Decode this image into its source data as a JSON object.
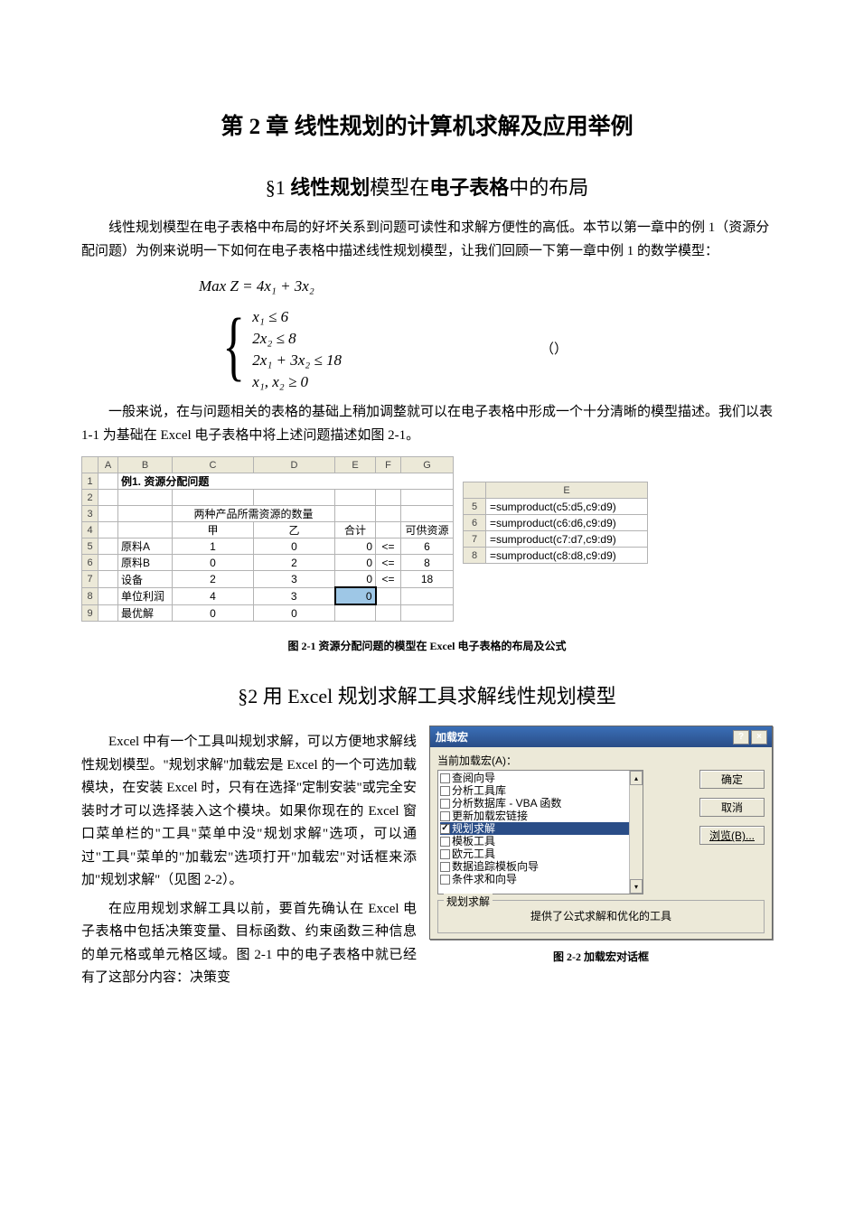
{
  "chapter": {
    "title": "第 2 章  线性规划的计算机求解及应用举例"
  },
  "section1": {
    "title_prefix": "§1 ",
    "title_b1": "线性规划",
    "title_r1": "模型在",
    "title_b2": "电子表格",
    "title_r2": "中的布局",
    "para1": "线性规划模型在电子表格中布局的好坏关系到问题可读性和求解方便性的高低。本节以第一章中的例 1（资源分配问题）为例来说明一下如何在电子表格中描述线性规划模型，让我们回顾一下第一章中例 1 的数学模型：",
    "math": {
      "objective": "Max    Z = 4x₁ + 3x₂",
      "c1": "x₁ ≤ 6",
      "c2": "2x₂ ≤ 8",
      "c3": "2x₁ + 3x₂ ≤ 18",
      "c4": "x₁, x₂ ≥ 0",
      "paren": "（）"
    },
    "para2": "一般来说，在与问题相关的表格的基础上稍加调整就可以在电子表格中形成一个十分清晰的模型描述。我们以表 1-1 为基础在 Excel 电子表格中将上述问题描述如图 2-1。"
  },
  "figure21": {
    "left_table": {
      "col_headers": [
        "",
        "A",
        "B",
        "C",
        "D",
        "E",
        "F",
        "G"
      ],
      "row_headers": [
        "1",
        "2",
        "3",
        "4",
        "5",
        "6",
        "7",
        "8",
        "9"
      ],
      "r1_b": "例1. 资源分配问题",
      "r3_cd": "两种产品所需资源的数量",
      "r4_c": "甲",
      "r4_d": "乙",
      "r4_e": "合计",
      "r4_g": "可供资源",
      "r5_b": "原料A",
      "r5_c": "1",
      "r5_d": "0",
      "r5_e": "0",
      "r5_f": "<=",
      "r5_g": "6",
      "r6_b": "原料B",
      "r6_c": "0",
      "r6_d": "2",
      "r6_e": "0",
      "r6_f": "<=",
      "r6_g": "8",
      "r7_b": "设备",
      "r7_c": "2",
      "r7_d": "3",
      "r7_e": "0",
      "r7_f": "<=",
      "r7_g": "18",
      "r8_b": "单位利润",
      "r8_c": "4",
      "r8_d": "3",
      "r8_e": "0",
      "r9_b": "最优解",
      "r9_c": "0",
      "r9_d": "0"
    },
    "right_table": {
      "header": "E",
      "rows": [
        {
          "n": "5",
          "f": "=sumproduct(c5:d5,c9:d9)"
        },
        {
          "n": "6",
          "f": "=sumproduct(c6:d6,c9:d9)"
        },
        {
          "n": "7",
          "f": "=sumproduct(c7:d7,c9:d9)"
        },
        {
          "n": "8",
          "f": "=sumproduct(c8:d8,c9:d9)"
        }
      ]
    },
    "caption": "图 2-1  资源分配问题的模型在 Excel  电子表格的布局及公式"
  },
  "section2": {
    "title": "§2 用 Excel 规划求解工具求解线性规划模型",
    "para1": "Excel 中有一个工具叫规划求解，可以方便地求解线性规划模型。\"规划求解\"加载宏是 Excel 的一个可选加载模块，在安装 Excel 时，只有在选择\"定制安装\"或完全安装时才可以选择装入这个模块。如果你现在的 Excel 窗口菜单栏的\"工具\"菜单中没\"规划求解\"选项，可以通过\"工具\"菜单的\"加载宏\"选项打开\"加载宏\"对话框来添加\"规划求解\"（见图 2-2）。",
    "para2": "在应用规划求解工具以前，要首先确认在 Excel 电子表格中包括决策变量、目标函数、约束函数三种信息的单元格或单元格区域。图 2-1 中的电子表格中就已经有了这部分内容：决策变"
  },
  "dialog": {
    "title": "加载宏",
    "list_label": "当前加载宏(A)：",
    "items": [
      {
        "label": "查阅向导",
        "checked": false
      },
      {
        "label": "分析工具库",
        "checked": false
      },
      {
        "label": "分析数据库 - VBA 函数",
        "checked": false
      },
      {
        "label": "更新加载宏链接",
        "checked": false
      },
      {
        "label": "规划求解",
        "checked": true,
        "selected": true
      },
      {
        "label": "模板工具",
        "checked": false
      },
      {
        "label": "欧元工具",
        "checked": false
      },
      {
        "label": "数据追踪模板向导",
        "checked": false
      },
      {
        "label": "条件求和向导",
        "checked": false
      }
    ],
    "buttons": {
      "ok": "确定",
      "cancel": "取消",
      "browse": "浏览(B)..."
    },
    "group_title": "规划求解",
    "group_desc": "提供了公式求解和优化的工具",
    "caption": "图 2-2  加载宏对话框"
  }
}
